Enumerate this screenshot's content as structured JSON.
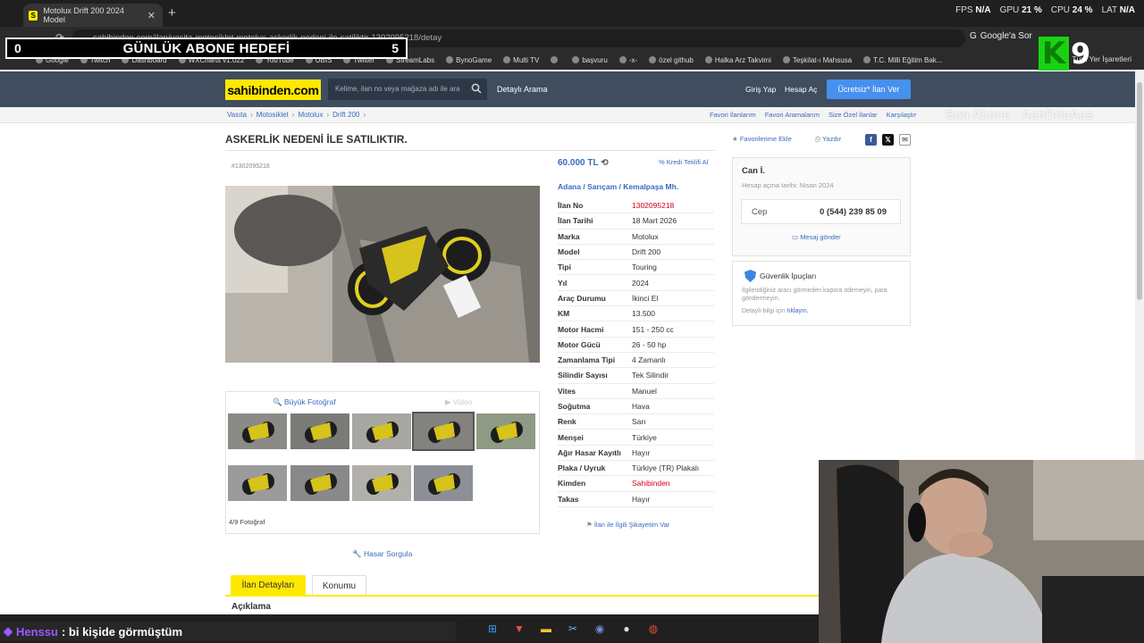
{
  "browser": {
    "tab_title": "Motolux Drift 200 2024 Model",
    "url": "sahibinden.com/ilan/vasita-motosiklet-motolux-askerlik-nedeni-ile-satiliktir-1302095218/detay",
    "google_sor": "Google'a Sor",
    "bookmarks": [
      "Google",
      "Twitch",
      "Dashboard",
      "WXCharts v1.022",
      "YouTube",
      "UBIS",
      "Twitter",
      "StreamLabs",
      "BynoGame",
      "Multi TV",
      "",
      "başvuru",
      "-x-",
      "özel github",
      "Halka Arz Takvimi",
      "Teşkilat-ı Mahsusa",
      "T.C. Milli Eğitim Bak..."
    ],
    "bookmarks_right": "Tüm Yer İşaretleri"
  },
  "hud": {
    "fps_label": "FPS",
    "fps": "N/A",
    "gpu_label": "GPU",
    "gpu": "21 %",
    "cpu_label": "CPU",
    "cpu": "24 %",
    "lat_label": "LAT",
    "lat": "N/A"
  },
  "overlay": {
    "goal_left": "0",
    "goal_title": "GÜNLÜK ABONE HEDEFİ",
    "goal_right": "5",
    "logo_letter": "K",
    "logo_number": "9",
    "last_sub": "Son Abone : AahDrlaAas"
  },
  "site": {
    "logo": "sahibinden.com",
    "search_placeholder": "Kelime, ilan no veya mağaza adı ile ara",
    "detailed_search": "Detaylı Arama",
    "login": "Giriş Yap",
    "register": "Hesap Aç",
    "post_ad": "Ücretsiz* İlan Ver"
  },
  "breadcrumb": [
    "Vasıta",
    "Motosiklet",
    "Motolux",
    "Drift 200"
  ],
  "crumb_links": [
    "Favori İlanlarım",
    "Favori Aramalarım",
    "Size Özel İlanlar",
    "Karşılaştır"
  ],
  "listing": {
    "title": "ASKERLİK NEDENİ İLE SATILIKTIR.",
    "id_small": "#1302095218",
    "fav_add": "Favorilerime Ekle",
    "print": "Yazdır",
    "price": "60.000 TL",
    "credit": "Kredi Teklifi Al",
    "location": [
      "Adana",
      "Sarıçam",
      "Kemalpaşa Mh."
    ],
    "big_photo": "Büyük Fotoğraf",
    "video": "Video",
    "photo_count": "4/9 Fotoğraf",
    "damage_check": "Hasar Sorgula",
    "complaint": "İlan ile İlgili Şikayetim Var",
    "details": [
      {
        "k": "İlan No",
        "v": "1302095218",
        "red": true
      },
      {
        "k": "İlan Tarihi",
        "v": "18 Mart 2026"
      },
      {
        "k": "Marka",
        "v": "Motolux"
      },
      {
        "k": "Model",
        "v": "Drift 200"
      },
      {
        "k": "Tipi",
        "v": "Touring"
      },
      {
        "k": "Yıl",
        "v": "2024"
      },
      {
        "k": "Araç Durumu",
        "v": "İkinci El"
      },
      {
        "k": "KM",
        "v": "13.500"
      },
      {
        "k": "Motor Hacmi",
        "v": "151 - 250 cc"
      },
      {
        "k": "Motor Gücü",
        "v": "26 - 50 hp"
      },
      {
        "k": "Zamanlama Tipi",
        "v": "4 Zamanlı"
      },
      {
        "k": "Silindir Sayısı",
        "v": "Tek Silindir"
      },
      {
        "k": "Vites",
        "v": "Manuel"
      },
      {
        "k": "Soğutma",
        "v": "Hava"
      },
      {
        "k": "Renk",
        "v": "Sarı"
      },
      {
        "k": "Menşei",
        "v": "Türkiye"
      },
      {
        "k": "Ağır Hasar Kayıtlı",
        "v": "Hayır"
      },
      {
        "k": "Plaka / Uyruk",
        "v": "Türkiye (TR) Plakalı"
      },
      {
        "k": "Kimden",
        "v": "Sahibinden",
        "red": true
      },
      {
        "k": "Takas",
        "v": "Hayır"
      }
    ]
  },
  "seller": {
    "name": "Can İ.",
    "joined": "Hesap açma tarihi: Nisan 2024",
    "phone_label": "Cep",
    "phone": "0 (544) 239 85 09",
    "message": "Mesaj gönder"
  },
  "safety": {
    "title": "Güvenlik İpuçları",
    "text": "İlgilendiğiniz aracı görmeden kapora ödemeyin, para göndermeyin.",
    "more_prefix": "Detaylı bilgi için",
    "more_link": "tıklayın."
  },
  "bottom_tabs": {
    "details": "İlan Detayları",
    "location": "Konumu",
    "description": "Açıklama"
  },
  "chat": {
    "user": "Henssu",
    "message": ": bi kişide görmüştüm"
  },
  "colors": {
    "brand": "#ffe800",
    "link": "#3a6abf",
    "header": "#3f4d5e",
    "accent_button": "#4690ef",
    "red": "#d0021b"
  }
}
